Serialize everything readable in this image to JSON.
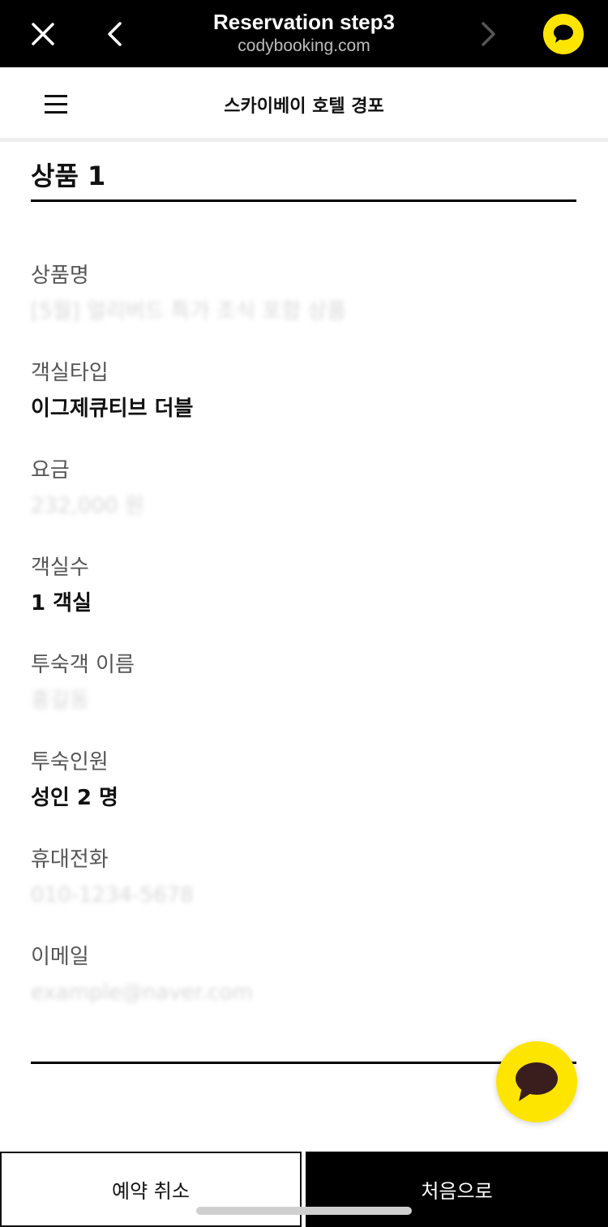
{
  "browser": {
    "title": "Reservation step3",
    "url": "codybooking.com",
    "icons": {
      "close": "close-icon",
      "back": "chevron-left-icon",
      "forward": "chevron-right-icon",
      "chat": "kakao-chat-icon"
    }
  },
  "header": {
    "hotel_name": "스카이베이 호텔 경포",
    "menu_icon": "hamburger-menu-icon"
  },
  "product": {
    "title": "상품 1",
    "fields": [
      {
        "label": "상품명",
        "value": "[5월] 얼리버드 특가 조식 포함 상품",
        "blurred": true
      },
      {
        "label": "객실타입",
        "value": "이그제큐티브 더블",
        "blurred": false
      },
      {
        "label": "요금",
        "value": "232,000 원",
        "blurred": true
      },
      {
        "label": "객실수",
        "value": "1 객실",
        "blurred": false
      },
      {
        "label": "투숙객 이름",
        "value": "홍길동",
        "blurred": true
      },
      {
        "label": "투숙인원",
        "value": "성인 2 명",
        "blurred": false
      },
      {
        "label": "휴대전화",
        "value": "010-1234-5678",
        "blurred": true
      },
      {
        "label": "이메일",
        "value": "example@naver.com",
        "blurred": true
      }
    ]
  },
  "buttons": {
    "cancel": "예약 취소",
    "home": "처음으로"
  },
  "colors": {
    "kakao_yellow": "#FEE500",
    "bar_black": "#000000"
  }
}
